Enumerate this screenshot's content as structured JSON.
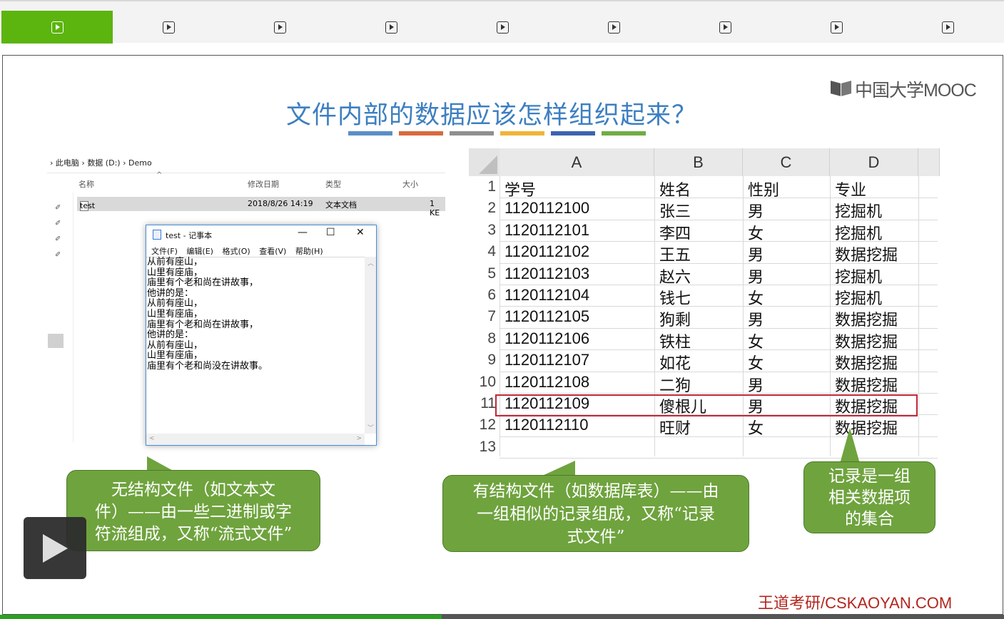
{
  "tabs": {
    "count": 9,
    "active_index": 0,
    "icon": "play-square-icon",
    "active_color": "#5cb40e"
  },
  "slide": {
    "title": "文件内部的数据应该怎样组织起来？",
    "title_color": "#3d7fc0",
    "underline_colors": [
      "#5b8ec7",
      "#d9693f",
      "#8f8f8f",
      "#f0b539",
      "#3e62b0",
      "#6fad44"
    ],
    "logo_text": "中国大学MOOC",
    "brand": "王道考研/CSKAOYAN.COM"
  },
  "explorer": {
    "breadcrumb": [
      "此电脑",
      "数据 (D:)",
      "Demo"
    ],
    "columns": [
      "名称",
      "修改日期",
      "类型",
      "大小"
    ],
    "file": {
      "name": "test",
      "date": "2018/8/26 14:19",
      "type": "文本文档",
      "size": "1 KE"
    }
  },
  "notepad": {
    "title": "test - 记事本",
    "menus": [
      "文件(F)",
      "编辑(E)",
      "格式(O)",
      "查看(V)",
      "帮助(H)"
    ],
    "lines": [
      "从前有座山，",
      "山里有座庙，",
      "庙里有个老和尚在讲故事，",
      "他讲的是：",
      "从前有座山，",
      "山里有座庙，",
      "庙里有个老和尚在讲故事，",
      "他讲的是：",
      "从前有座山，",
      "山里有座庙，",
      "庙里有个老和尚没在讲故事。"
    ]
  },
  "sheet": {
    "columns": [
      "A",
      "B",
      "C",
      "D"
    ],
    "row_numbers": [
      "1",
      "2",
      "3",
      "4",
      "5",
      "6",
      "7",
      "8",
      "9",
      "10",
      "11",
      "12",
      "13"
    ],
    "rows": [
      [
        "学号",
        "姓名",
        "性别",
        "专业"
      ],
      [
        "1120112100",
        "张三",
        "男",
        "挖掘机"
      ],
      [
        "1120112101",
        "李四",
        "女",
        "挖掘机"
      ],
      [
        "1120112102",
        "王五",
        "男",
        "数据挖掘"
      ],
      [
        "1120112103",
        "赵六",
        "男",
        "挖掘机"
      ],
      [
        "1120112104",
        "钱七",
        "女",
        "挖掘机"
      ],
      [
        "1120112105",
        "狗剩",
        "男",
        "数据挖掘"
      ],
      [
        "1120112106",
        "铁柱",
        "女",
        "数据挖掘"
      ],
      [
        "1120112107",
        "如花",
        "女",
        "数据挖掘"
      ],
      [
        "1120112108",
        "二狗",
        "男",
        "数据挖掘"
      ],
      [
        "1120112109",
        "傻根儿",
        "男",
        "数据挖掘"
      ],
      [
        "1120112110",
        "旺财",
        "女",
        "数据挖掘"
      ]
    ],
    "highlighted_row": 11
  },
  "callouts": {
    "left": [
      "无结构文件（如文本文",
      "件）——由一些二进制或字",
      "符流组成，又称“流式文件”"
    ],
    "middle": [
      "有结构文件（如数据库表）——由",
      "一组相似的记录组成，又称“记录",
      "式文件”"
    ],
    "right": [
      "记录是一组",
      "相关数据项",
      "的集合"
    ]
  },
  "player": {
    "progress": 0.44
  }
}
